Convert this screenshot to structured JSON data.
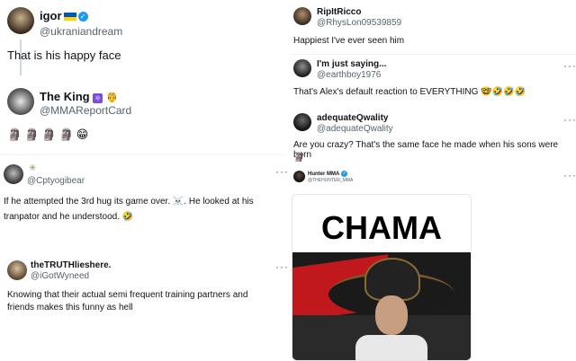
{
  "left": {
    "t1": {
      "name": "igor",
      "handle": "@ukraniandream",
      "text": "That is his happy face"
    },
    "t2": {
      "name": "The King",
      "handle": "@MMAReportCard",
      "text": "🗿🗿🗿🗿😁"
    },
    "t3": {
      "name": "",
      "handle": "@Cptyogibear",
      "text": "If he attempted the 3rd hug its game over. ☠️. He looked at his tranpator and he understood. 🤣",
      "more": "···"
    },
    "t4": {
      "name": "theTRUTHlieshere.",
      "handle": "@iGotWyneed",
      "text": "Knowing that their actual semi frequent training partners and friends makes this funny as hell",
      "more": "···"
    }
  },
  "right": {
    "r1": {
      "name": "RipItRicco",
      "handle": "@RhysLon09539859",
      "text": "Happiest I've ever seen him"
    },
    "r2": {
      "name": "I'm just saying...",
      "handle": "@earthboy1976",
      "text": "That's Alex's default reaction to EVERYTHING 🤓🤣🤣🤣",
      "more": "···"
    },
    "r3": {
      "name": "adequateQwality",
      "handle": "@adequateQwality",
      "text": "Are you crazy? That's the same face he made when his sons were born",
      "emoji": "🗿",
      "more": "···"
    },
    "r4": {
      "name": "Hunter MMA",
      "handle": "@THEHUNTER_MMA",
      "more": "···",
      "image_caption": "CHAMA"
    }
  },
  "colors": {
    "verified": "#1d9bf0",
    "text": "#0f1419",
    "muted": "#536471"
  }
}
